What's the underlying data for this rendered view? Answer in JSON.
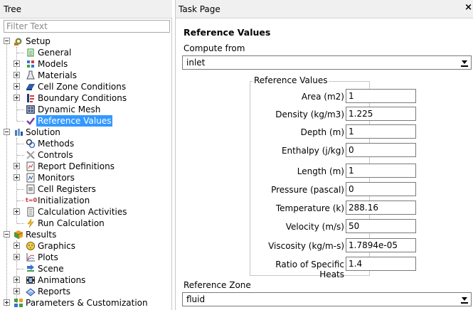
{
  "tree_panel": {
    "title": "Tree",
    "filter_placeholder": "Filter Text",
    "items": [
      {
        "label": "Setup",
        "icon": "setup-icon"
      },
      {
        "label": "General",
        "icon": "general-icon"
      },
      {
        "label": "Models",
        "icon": "models-icon"
      },
      {
        "label": "Materials",
        "icon": "materials-icon"
      },
      {
        "label": "Cell Zone Conditions",
        "icon": "cell-zone-icon"
      },
      {
        "label": "Boundary Conditions",
        "icon": "boundary-icon"
      },
      {
        "label": "Dynamic Mesh",
        "icon": "dynamic-mesh-icon"
      },
      {
        "label": "Reference Values",
        "icon": "reference-values-icon"
      },
      {
        "label": "Solution",
        "icon": "solution-icon"
      },
      {
        "label": "Methods",
        "icon": "methods-icon"
      },
      {
        "label": "Controls",
        "icon": "controls-icon"
      },
      {
        "label": "Report Definitions",
        "icon": "report-definitions-icon"
      },
      {
        "label": "Monitors",
        "icon": "monitors-icon"
      },
      {
        "label": "Cell Registers",
        "icon": "cell-registers-icon"
      },
      {
        "label": "Initialization",
        "icon": "initialization-icon"
      },
      {
        "label": "Calculation Activities",
        "icon": "calculation-activities-icon"
      },
      {
        "label": "Run Calculation",
        "icon": "run-calculation-icon"
      },
      {
        "label": "Results",
        "icon": "results-icon"
      },
      {
        "label": "Graphics",
        "icon": "graphics-icon"
      },
      {
        "label": "Plots",
        "icon": "plots-icon"
      },
      {
        "label": "Scene",
        "icon": "scene-icon"
      },
      {
        "label": "Animations",
        "icon": "animations-icon"
      },
      {
        "label": "Reports",
        "icon": "reports-icon"
      },
      {
        "label": "Parameters & Customization",
        "icon": "parameters-icon"
      }
    ],
    "selected": "Reference Values"
  },
  "task_page": {
    "header": "Task Page",
    "close_glyph": "×",
    "title": "Reference Values",
    "compute_from_label": "Compute from",
    "compute_from_value": "inlet",
    "group_title": "Reference Values",
    "fields": [
      {
        "label": "Area (m2)",
        "value": "1"
      },
      {
        "label": "Density (kg/m3)",
        "value": "1.225"
      },
      {
        "label": "Depth (m)",
        "value": "1"
      },
      {
        "label": "Enthalpy (j/kg)",
        "value": "0"
      },
      {
        "label": "Length (m)",
        "value": "1"
      },
      {
        "label": "Pressure (pascal)",
        "value": "0"
      },
      {
        "label": "Temperature (k)",
        "value": "288.16"
      },
      {
        "label": "Velocity (m/s)",
        "value": "50"
      },
      {
        "label": "Viscosity (kg/m-s)",
        "value": "1.7894e-05"
      },
      {
        "label": "Ratio of Specific Heats",
        "value": "1.4"
      }
    ],
    "reference_zone_label": "Reference Zone",
    "reference_zone_value": "fluid"
  },
  "colors": {
    "selection": "#3399ff",
    "header_bg": "#f0f0f0"
  }
}
